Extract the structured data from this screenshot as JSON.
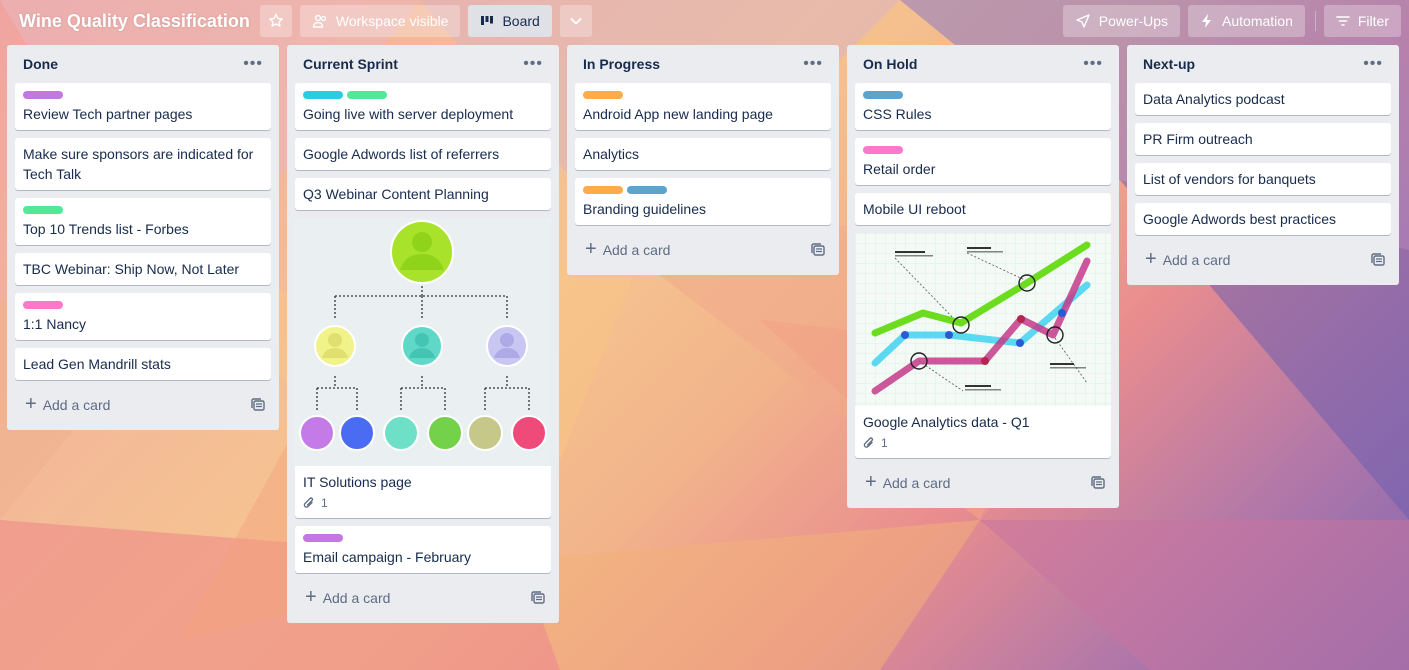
{
  "header": {
    "board_title": "Wine Quality Classification",
    "workspace_visible": "Workspace visible",
    "board_view": "Board",
    "power_ups": "Power-Ups",
    "automation": "Automation",
    "filter": "Filter"
  },
  "add_card_label": "Add a card",
  "colors": {
    "label_purple": "#c377e0",
    "label_sky": "#29cce5",
    "label_green": "#51e898",
    "label_orange": "#ffab4a",
    "label_blue": "#5ba4cf",
    "label_pink": "#ff78cb",
    "list_bg": "#ebecf0"
  },
  "lists": [
    {
      "title": "Done",
      "cards": [
        {
          "title": "Review Tech partner pages",
          "labels": [
            "purple"
          ]
        },
        {
          "title": "Make sure sponsors are indicated for Tech Talk",
          "labels": []
        },
        {
          "title": "Top 10 Trends list - Forbes",
          "labels": [
            "green"
          ]
        },
        {
          "title": "TBC Webinar: Ship Now, Not Later",
          "labels": []
        },
        {
          "title": "1:1 Nancy",
          "labels": [
            "pink"
          ]
        },
        {
          "title": "Lead Gen Mandrill stats",
          "labels": []
        }
      ]
    },
    {
      "title": "Current Sprint",
      "cards": [
        {
          "title": "Going live with server deployment",
          "labels": [
            "sky",
            "green"
          ]
        },
        {
          "title": "Google Adwords list of referrers",
          "labels": []
        },
        {
          "title": "Q3 Webinar Content Planning",
          "labels": []
        },
        {
          "title": "IT Solutions page",
          "labels": [],
          "cover": "org-chart-image",
          "attachments": "1"
        },
        {
          "title": "Email campaign - February",
          "labels": [
            "purple"
          ]
        }
      ]
    },
    {
      "title": "In Progress",
      "cards": [
        {
          "title": "Android App new landing page",
          "labels": [
            "orange"
          ]
        },
        {
          "title": "Analytics",
          "labels": []
        },
        {
          "title": "Branding guidelines",
          "labels": [
            "orange",
            "blue"
          ]
        }
      ]
    },
    {
      "title": "On Hold",
      "cards": [
        {
          "title": "CSS Rules",
          "labels": [
            "blue"
          ]
        },
        {
          "title": "Retail order",
          "labels": [
            "pink"
          ]
        },
        {
          "title": "Mobile UI reboot",
          "labels": []
        },
        {
          "title": "Google Analytics data - Q1",
          "labels": [],
          "cover": "line-chart-image",
          "attachments": "1"
        }
      ]
    },
    {
      "title": "Next-up",
      "cards": [
        {
          "title": "Data Analytics podcast",
          "labels": []
        },
        {
          "title": "PR Firm outreach",
          "labels": []
        },
        {
          "title": "List of vendors for banquets",
          "labels": []
        },
        {
          "title": "Google Adwords best practices",
          "labels": []
        }
      ]
    }
  ]
}
